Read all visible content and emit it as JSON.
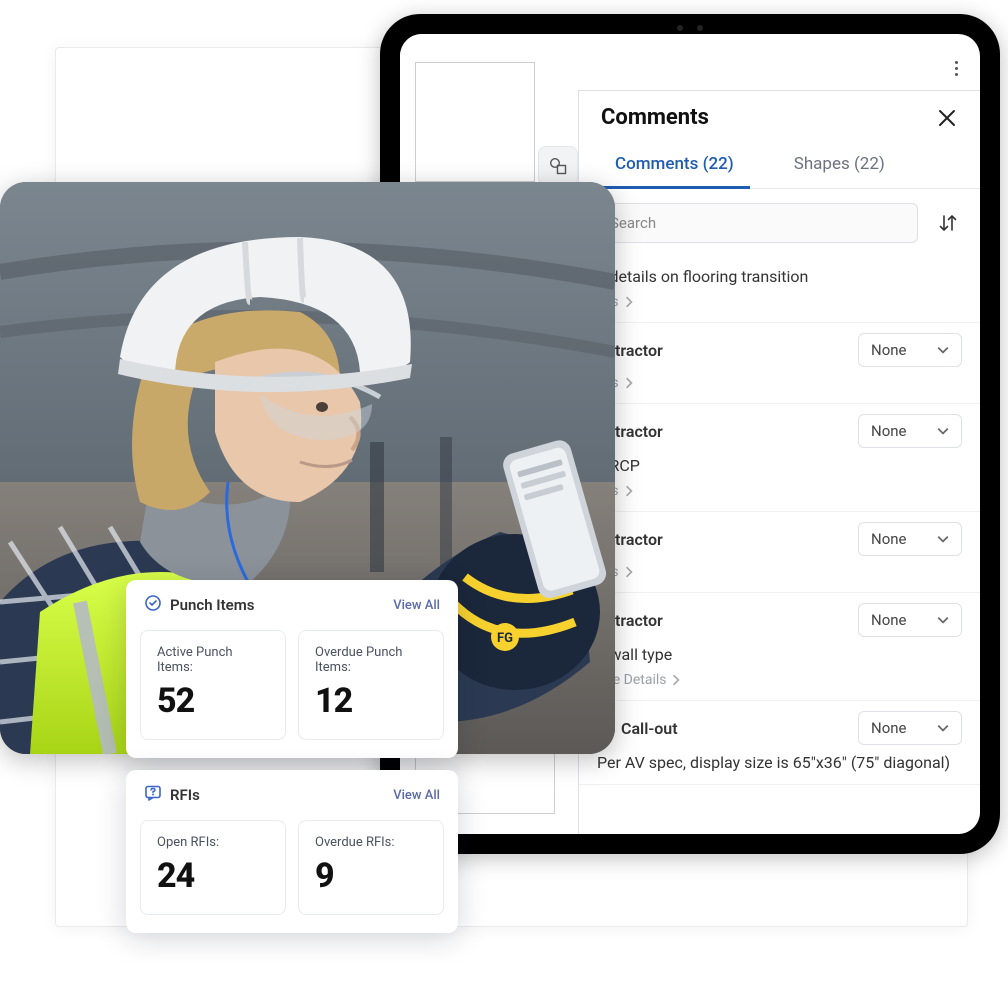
{
  "panel": {
    "title": "Comments",
    "close_label": "Close",
    "tabs": {
      "comments": "Comments (22)",
      "shapes": "Shapes (22)"
    },
    "search": {
      "placeholder": "Search"
    },
    "sort_label": "Sort",
    "items": [
      {
        "text": "e details on flooring transition",
        "heading": "",
        "selected": "",
        "details": "ails"
      },
      {
        "text": "",
        "heading": "ontractor",
        "selected": "None",
        "details": "ails"
      },
      {
        "text": "e RCP",
        "heading": "ontractor",
        "selected": "None",
        "details": "ails"
      },
      {
        "text": "",
        "heading": "ontractor",
        "selected": "None",
        "details": "ails"
      },
      {
        "text": "e wall type",
        "heading": "ontractor",
        "selected": "None",
        "details": "See Details"
      },
      {
        "text": "Per AV spec, display size is 65\"x36\" (75\" diagonal)",
        "heading": "Call-out",
        "selected": "None",
        "details": ""
      }
    ]
  },
  "cards": {
    "punch": {
      "title": "Punch Items",
      "view_all": "View All",
      "active_label": "Active Punch Items:",
      "active_value": "52",
      "overdue_label": "Overdue Punch Items:",
      "overdue_value": "12"
    },
    "rfis": {
      "title": "RFIs",
      "view_all": "View All",
      "open_label": "Open RFIs:",
      "open_value": "24",
      "overdue_label": "Overdue RFIs:",
      "overdue_value": "9"
    }
  }
}
